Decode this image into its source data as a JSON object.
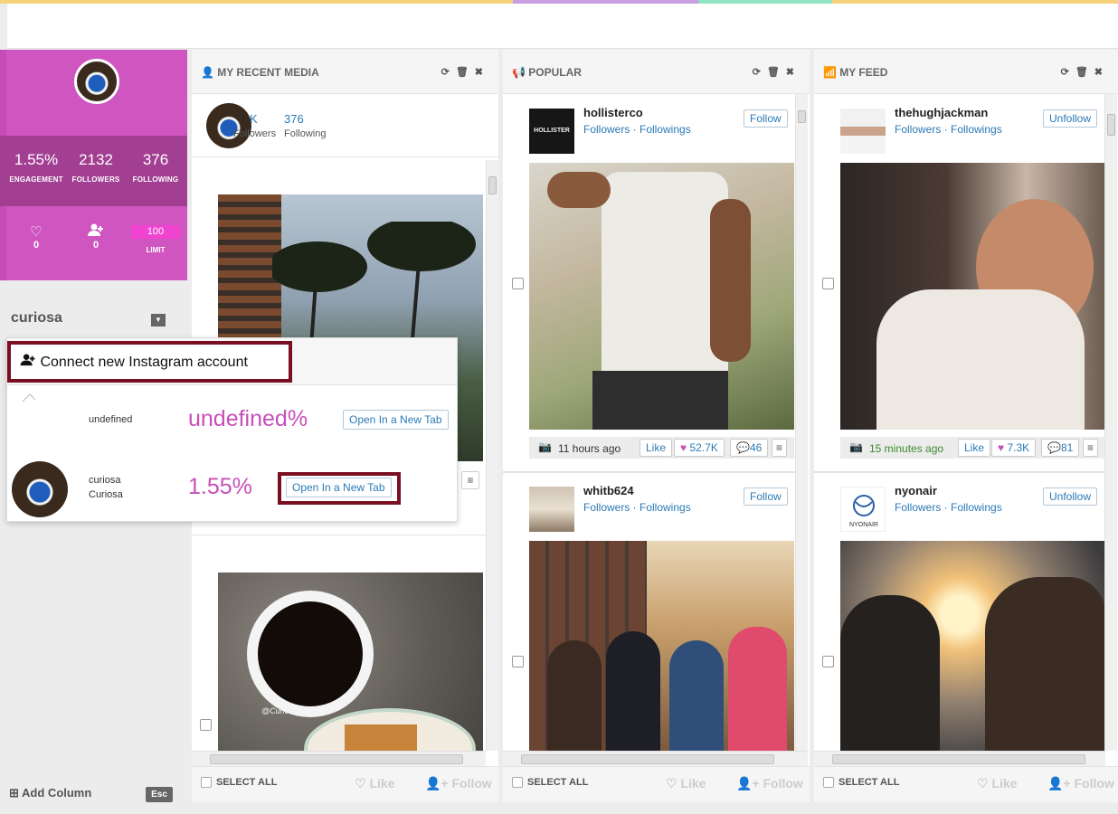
{
  "colors": {
    "accent": "#cf55c0",
    "accent_dark": "#a23f93",
    "link": "#2a7ab7",
    "highlight_border": "#7a0f23",
    "stripe": [
      "#f6d27d",
      "#c99ee0",
      "#8fe4c4",
      "#f6d27d"
    ]
  },
  "profile": {
    "stats": [
      {
        "value": "1.55%",
        "label": "ENGAGEMENT"
      },
      {
        "value": "2132",
        "label": "FOLLOWERS"
      },
      {
        "value": "376",
        "label": "FOLLOWING"
      }
    ],
    "likes": {
      "icon": "heart-outline-icon",
      "value": "0"
    },
    "follows": {
      "icon": "user-plus-icon",
      "value": "0"
    },
    "limit": {
      "value": "100",
      "label": "LIMIT"
    },
    "account_name": "curiosa",
    "add_column": "Add Column",
    "esc": "Esc"
  },
  "columns": [
    {
      "title": "MY RECENT MEDIA",
      "icon": "user-icon",
      "summary": {
        "followers_value": "K",
        "followers_label": "Followers",
        "following_value": "376",
        "following_label": "Following"
      },
      "watermark": "@Curiosa"
    },
    {
      "title": "POPULAR",
      "icon": "megaphone-icon",
      "posts": [
        {
          "user": "hollisterco",
          "links": "Followers · Followings",
          "button": "Follow",
          "time": "11 hours ago",
          "like": "Like",
          "likes": "52.7K",
          "comments": "46"
        },
        {
          "user": "whitb624",
          "links": "Followers · Followings",
          "button": "Follow"
        }
      ]
    },
    {
      "title": "MY FEED",
      "icon": "rss-icon",
      "posts": [
        {
          "user": "thehughjackman",
          "links": "Followers · Followings",
          "button": "Unfollow",
          "time": "15 minutes ago",
          "like": "Like",
          "likes": "7.3K",
          "comments": "81"
        },
        {
          "user": "nyonair",
          "links": "Followers · Followings",
          "button": "Unfollow",
          "logo_text": "NYONAIR"
        }
      ]
    }
  ],
  "footer": {
    "select_all": "SELECT ALL",
    "like": "Like",
    "follow": "Follow"
  },
  "overlay": {
    "connect_label": "Connect new Instagram account",
    "accounts": [
      {
        "name": "undefined",
        "display": "",
        "pct": "undefined%",
        "button": "Open In a New Tab"
      },
      {
        "name": "curiosa",
        "display": "Curiosa",
        "pct": "1.55%",
        "button": "Open In a New Tab"
      }
    ]
  }
}
